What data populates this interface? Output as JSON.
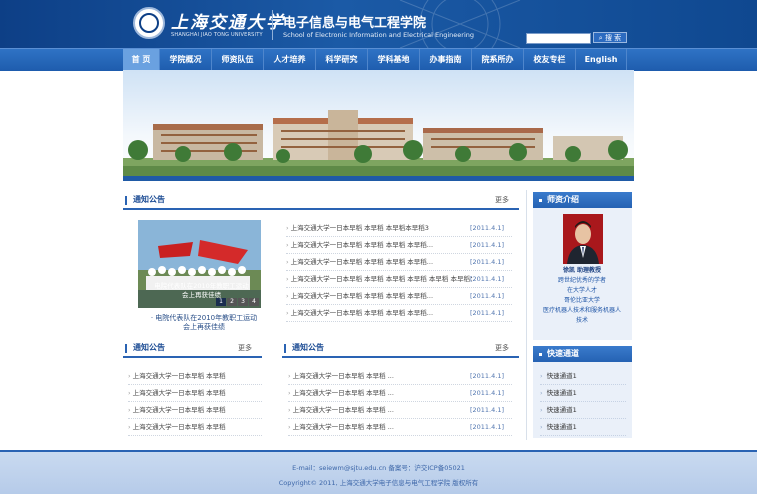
{
  "header": {
    "uni_cn": "上海交通大学",
    "uni_en": "SHANGHAI JIAO TONG UNIVERSITY",
    "school_cn": "电子信息与电气工程学院",
    "school_en": "School of Electronic Information and Electrical Engineering",
    "search_label": "搜 索"
  },
  "nav": {
    "items": [
      "首 页",
      "学院概况",
      "师资队伍",
      "人才培养",
      "科学研究",
      "学科基地",
      "办事指南",
      "院系所办",
      "校友专栏",
      "English"
    ]
  },
  "notice1": {
    "title": "通知公告",
    "more": "更多",
    "photo_overlay": "电院代表队在2010年教职工运动会上再获佳绩",
    "photo_pages": [
      "1",
      "2",
      "3",
      "4"
    ],
    "photo_caption": "· 电院代表队在2010年教职工运动会上再获佳绩",
    "items": [
      {
        "text": "上海交通大学一日本早稻 本早稻 本早稻本早稻3",
        "date": "[2011.4.1]"
      },
      {
        "text": "上海交通大学一日本早稻 本早稻 本早稻 本早稻...",
        "date": "[2011.4.1]"
      },
      {
        "text": "上海交通大学一日本早稻 本早稻 本早稻 本早稻...",
        "date": "[2011.4.1]"
      },
      {
        "text": "上海交通大学一日本早稻 本早稻 本早稻 本早稻 本早稻 本早稻：",
        "date": "[2011.4.1]"
      },
      {
        "text": "上海交通大学一日本早稻 本早稻 本早稻 本早稻...",
        "date": "[2011.4.1]"
      },
      {
        "text": "上海交通大学一日本早稻 本早稻 本早稻 本早稻...",
        "date": "[2011.4.1]"
      }
    ]
  },
  "notice2": {
    "title": "通知公告",
    "more": "更多",
    "items": [
      "上海交通大学一日本早稻 本早稻",
      "上海交通大学一日本早稻 本早稻",
      "上海交通大学一日本早稻 本早稻",
      "上海交通大学一日本早稻 本早稻"
    ]
  },
  "notice3": {
    "title": "通知公告",
    "more": "更多",
    "items": [
      {
        "text": "上海交通大学一日本早稻 本早稻 ...",
        "date": "[2011.4.1]"
      },
      {
        "text": "上海交通大学一日本早稻 本早稻 ...",
        "date": "[2011.4.1]"
      },
      {
        "text": "上海交通大学一日本早稻 本早稻 ...",
        "date": "[2011.4.1]"
      },
      {
        "text": "上海交通大学一日本早稻 本早稻 ...",
        "date": "[2011.4.1]"
      }
    ]
  },
  "faculty": {
    "title": "师资介绍",
    "name": "徐凯 助理教授",
    "lines": [
      "跨世纪优秀的学者",
      "在大学人才",
      "哥伦比亚大学",
      "医疗机器人技术和服务机器人",
      "技术"
    ]
  },
  "quick": {
    "title": "快速通道",
    "items": [
      "快速通道1",
      "快速通道1",
      "快速通道1",
      "快速通道1"
    ]
  },
  "footer": {
    "line1": "E-mail：seiewm@sjtu.edu.cn 备案号：沪交ICP备05021",
    "line2": "Copyright© 2011, 上海交通大学电子信息与电气工程学院 版权所有"
  }
}
